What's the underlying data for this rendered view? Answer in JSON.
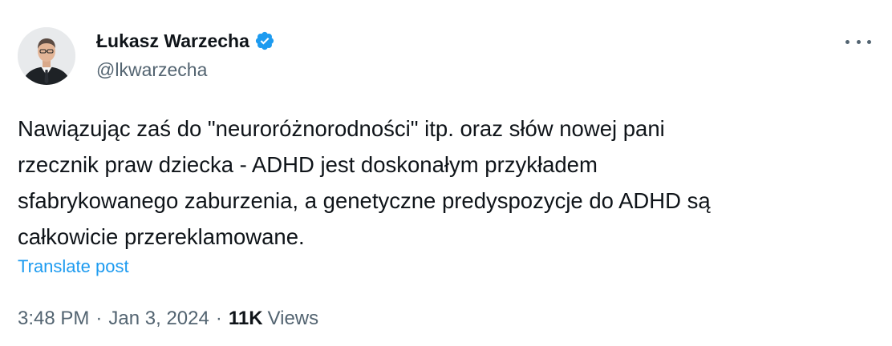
{
  "author": {
    "display_name": "Łukasz Warzecha",
    "handle": "@lkwarzecha",
    "verified_icon": "verified-badge-icon",
    "verified_color": "#1d9bf0"
  },
  "tweet": {
    "lines": [
      "Nawiązując zaś do \"neuroróżnorodności\" itp. oraz słów nowej pani",
      "rzecznik praw dziecka - ADHD jest doskonałym przykładem",
      "sfabrykowanego zaburzenia, a genetyczne predyspozycje do ADHD są",
      "całkowicie przereklamowane."
    ],
    "translate_label": "Translate post"
  },
  "meta": {
    "time": "3:48 PM",
    "separator": "·",
    "date": "Jan 3, 2024",
    "views_count": "11K",
    "views_label": "Views"
  },
  "colors": {
    "text": "#0f1419",
    "secondary": "#536471",
    "link": "#1d9bf0"
  }
}
